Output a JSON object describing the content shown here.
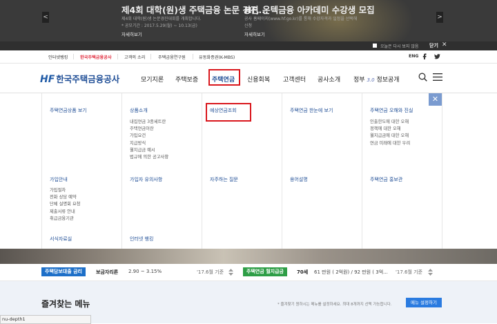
{
  "banner": {
    "left": {
      "title": "제4회 대학(원)생 주택금융 논문 경진...",
      "line1": "제4회 대학(원)생 논문경진대회를 개최합니다.",
      "line2": "* 공모기간 : 2017.5.29(월) ~ 10.13(금)",
      "more": "자세히보기"
    },
    "right": {
      "title": "HF, 온텍금융 아카데미 수강생 모집",
      "line1": "공사 홈페이지(www.hf.go.kr)를 통해 수강자격과 일정을 선택해",
      "line2": "신청",
      "more": "자세히보기"
    },
    "prev_icon": "<",
    "next_icon": ">",
    "no_show_today": "오늘은 다시 보지 않음",
    "close_label": "닫기",
    "close_icon": "✕"
  },
  "util_nav": {
    "items": [
      "인터넷뱅킹",
      "한국주택금융공사",
      "고객의 소리",
      "주택금융연구원",
      "유동화증권(K-MBS)"
    ],
    "lang": "ENG"
  },
  "header": {
    "logo_mark": "HF",
    "logo_text": "한국주택금융공사",
    "gnb": [
      "모기지론",
      "주택보증",
      "주택연금",
      "신용회복",
      "고객센터",
      "공사소개"
    ],
    "gnb_last": "정부 3.0 정보공개",
    "gnb_last_a": "정부",
    "gnb_last_b": "3.0",
    "gnb_last_c": "정보공개"
  },
  "mega": {
    "row1": [
      {
        "head": "주택연금상품 보기",
        "subs": []
      },
      {
        "head": "상품소개",
        "subs": [
          "내집연금 3종세트란",
          "주택연금이란",
          "가입요건",
          "지급방식",
          "월지급금 예시",
          "법규에 의한 공고사항"
        ]
      },
      {
        "head": "예상연금조회",
        "subs": []
      },
      {
        "head": "주택연금 한눈에 보기",
        "subs": []
      },
      {
        "head": "주택연금 오해와 진실",
        "subs": [
          "인출한도에 대한 오해",
          "정책에 대한 오해",
          "월지급금에 대한 오해",
          "연금 미래에 대한 우려"
        ]
      }
    ],
    "row2": [
      {
        "head": "가입안내",
        "subs": [
          "가입절차",
          "전화 상담 예약",
          "단체 설명회 요청",
          "제출서류 안내",
          "취급금융기관"
        ]
      },
      {
        "head": "가입자 유의사항",
        "subs": []
      },
      {
        "head": "자주하는 질문",
        "subs": []
      },
      {
        "head": "용어설명",
        "subs": []
      },
      {
        "head": "주택연금 홍보관",
        "subs": []
      }
    ],
    "row3": [
      {
        "head": "서식자료실"
      },
      {
        "head": "인터넷 뱅킹"
      }
    ],
    "close_icon": "✕"
  },
  "rates": {
    "loan_tag": "주택담보대출 금리",
    "loan_label": "보금자리론",
    "loan_value": "2.90 ~ 3.15%",
    "loan_date": "'17.6월 기준",
    "pension_tag": "주택연금 월지급금",
    "pension_age": "70세",
    "pension_value": "61 만원 ( 2억원) / 92 만원 ( 3억...",
    "pension_date": "'17.6월 기준"
  },
  "favorites": {
    "title": "즐겨찾는 메뉴",
    "note": "* 즐겨찾기 원하시는 메뉴를 설정하세요. 최대 8개까지 선택 가능합니다.",
    "button": "메뉴 설정하기"
  },
  "status_bar": "nu-depth1",
  "colors": {
    "accent_red": "#d9161c",
    "brand_blue": "#1f4e96",
    "tag_blue": "#1d6fc8",
    "tag_green": "#2e9e46"
  }
}
